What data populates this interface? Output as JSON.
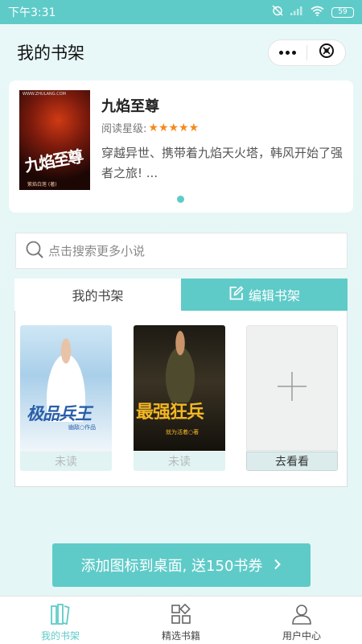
{
  "status_bar": {
    "time": "下午3:31",
    "battery": "59"
  },
  "header": {
    "title": "我的书架"
  },
  "featured": {
    "title": "九焰至尊",
    "rating_label": "阅读星级:",
    "stars": "★★★★★",
    "description": "穿越异世、携带着九焰天火塔，韩风开始了强者之旅! ...",
    "cover_title": "九焰至尊",
    "cover_top": "WWW.ZHULANG.COM",
    "cover_author": "紫焰白莲 (著)"
  },
  "search": {
    "placeholder": "点击搜索更多小说"
  },
  "tabs": {
    "shelf": "我的书架",
    "edit": "编辑书架"
  },
  "books": [
    {
      "cover_title": "极品兵王",
      "cover_sub": "幽敌○作品",
      "label": "未读"
    },
    {
      "cover_title": "最强狂兵",
      "cover_sub": "就为活着○著",
      "label": "未读"
    }
  ],
  "add_book": {
    "label": "去看看"
  },
  "promo": {
    "text": "添加图标到桌面, 送150书券"
  },
  "bottom_nav": [
    {
      "label": "我的书架"
    },
    {
      "label": "精选书籍"
    },
    {
      "label": "用户中心"
    }
  ],
  "colors": {
    "accent": "#5fcbc8",
    "star": "#f48a1c"
  }
}
